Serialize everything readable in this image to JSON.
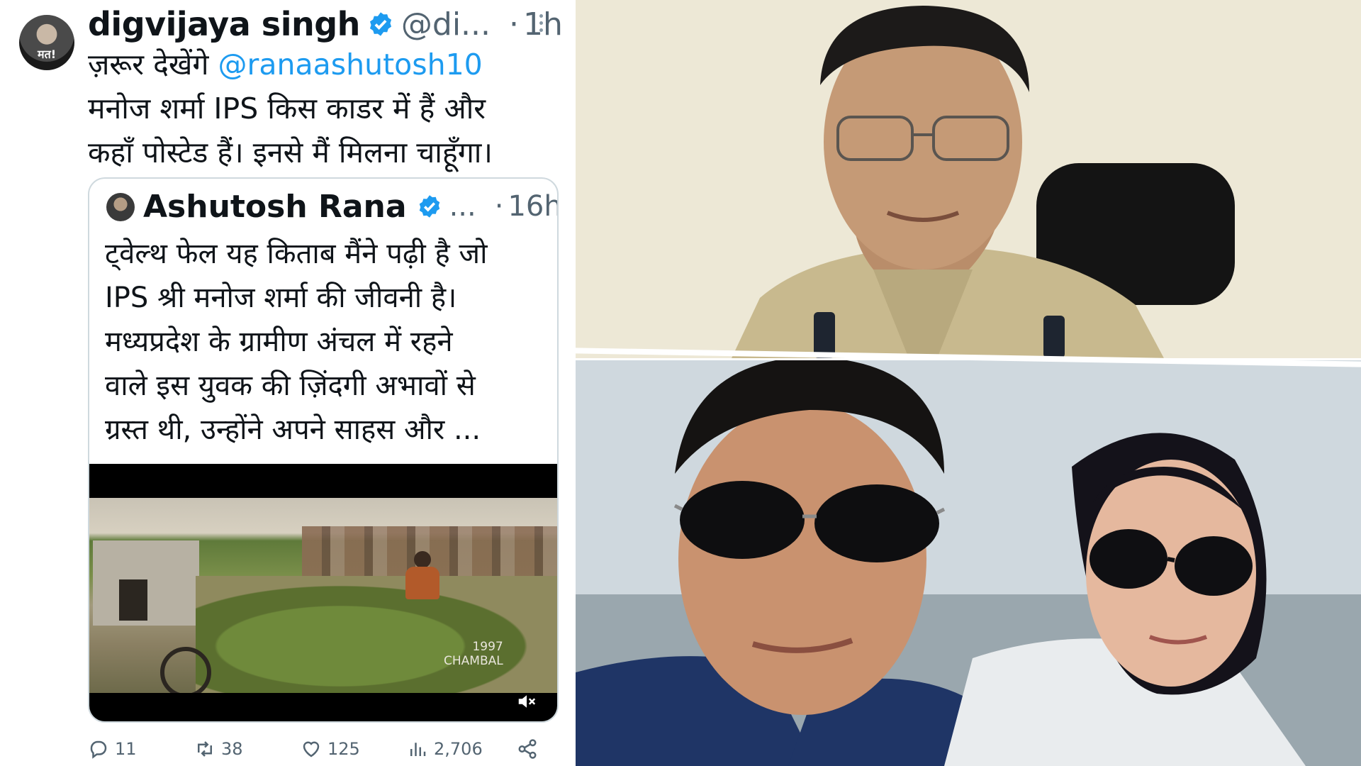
{
  "tweet": {
    "author_name": "digvijaya singh",
    "author_handle": "@di...",
    "time": "1h",
    "avatar_text": "मत!",
    "text_line1_prefix": "ज़रूर देखेंगे ",
    "mention": "@ranaashutosh10",
    "text_line2": "मनोज शर्मा IPS किस काडर में हैं और",
    "text_line3": "कहाँ पोस्टेड हैं। इनसे मैं मिलना चाहूँगा।",
    "quote": {
      "author_name": "Ashutosh Rana",
      "ellipsis": "...",
      "time": "16h",
      "lines": [
        "ट्वेल्थ फेल यह किताब मैंने पढ़ी है जो",
        "IPS श्री मनोज शर्मा की जीवनी है।",
        "मध्यप्रदेश के ग्रामीण अंचल में रहने",
        "वाले इस युवक की ज़िंदगी अभावों से",
        "ग्रस्त थी, उन्होंने अपने साहस और ..."
      ],
      "video_caption_year": "1997",
      "video_caption_place": "CHAMBAL"
    },
    "actions": {
      "replies": "11",
      "retweets": "38",
      "likes": "125",
      "views": "2,706"
    }
  },
  "colors": {
    "accent": "#1d9bf0",
    "text": "#0f1419",
    "muted": "#536471"
  }
}
